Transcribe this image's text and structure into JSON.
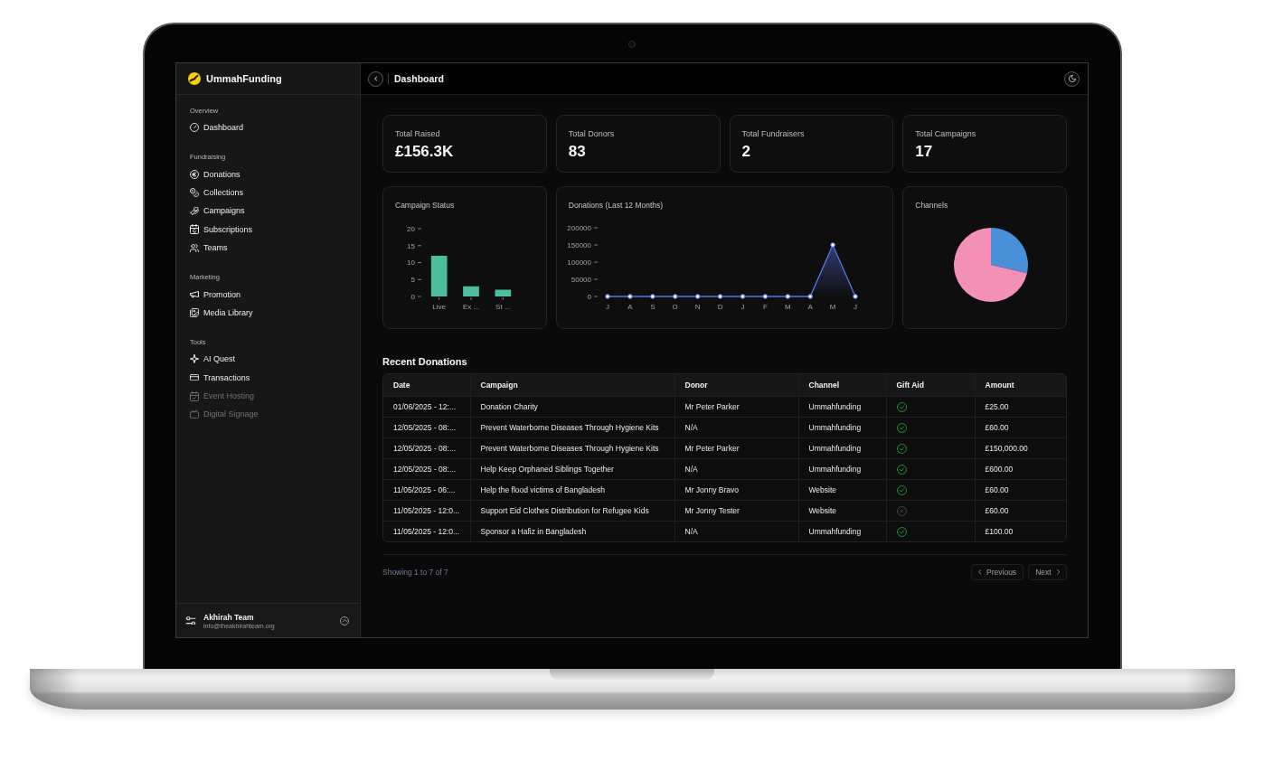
{
  "sidebar": {
    "brand": "UmmahFunding",
    "sections": [
      {
        "title": "Overview",
        "items": [
          {
            "label": "Dashboard",
            "disabled": false
          }
        ]
      },
      {
        "title": "Fundraising",
        "items": [
          {
            "label": "Donations",
            "disabled": false
          },
          {
            "label": "Collections",
            "disabled": false
          },
          {
            "label": "Campaigns",
            "disabled": false
          },
          {
            "label": "Subscriptions",
            "disabled": false
          },
          {
            "label": "Teams",
            "disabled": false
          }
        ]
      },
      {
        "title": "Marketing",
        "items": [
          {
            "label": "Promotion",
            "disabled": false
          },
          {
            "label": "Media Library",
            "disabled": false
          }
        ]
      },
      {
        "title": "Tools",
        "items": [
          {
            "label": "AI Quest",
            "disabled": false
          },
          {
            "label": "Transactions",
            "disabled": false
          },
          {
            "label": "Event Hosting",
            "disabled": true
          },
          {
            "label": "Digital Signage",
            "disabled": true
          }
        ]
      }
    ],
    "user": {
      "name": "Akhirah Team",
      "email": "info@theakhirahteam.org"
    }
  },
  "header": {
    "title": "Dashboard"
  },
  "stats": [
    {
      "label": "Total Raised",
      "value": "£156.3K"
    },
    {
      "label": "Total Donors",
      "value": "83"
    },
    {
      "label": "Total Fundraisers",
      "value": "2"
    },
    {
      "label": "Total Campaigns",
      "value": "17"
    }
  ],
  "charts": {
    "campaign_status": {
      "chart_data": {
        "type": "bar",
        "title": "Campaign Status",
        "categories": [
          "Live",
          "Ex ...",
          "St ..."
        ],
        "values": [
          12,
          3,
          2
        ],
        "ylim": [
          0,
          20
        ],
        "yticks": [
          0,
          5,
          10,
          15,
          20
        ]
      }
    },
    "donations": {
      "chart_data": {
        "type": "area",
        "title": "Donations (Last 12 Months)",
        "categories": [
          "J",
          "A",
          "S",
          "O",
          "N",
          "D",
          "J",
          "F",
          "M",
          "A",
          "M",
          "J"
        ],
        "values": [
          0,
          0,
          0,
          0,
          0,
          0,
          0,
          0,
          0,
          0,
          150000,
          0
        ],
        "ylim": [
          0,
          200000
        ],
        "yticks": [
          0,
          50000,
          100000,
          150000,
          200000
        ]
      }
    },
    "channels": {
      "chart_data": {
        "type": "pie",
        "title": "Channels",
        "values": [
          28.6,
          71.4
        ],
        "colors": [
          "#4a90d9",
          "#f48fb6"
        ]
      }
    }
  },
  "recent_donations": {
    "title": "Recent Donations",
    "columns": [
      "Date",
      "Campaign",
      "Donor",
      "Channel",
      "Gift Aid",
      "Amount"
    ],
    "rows": [
      {
        "date": "01/06/2025 - 12:...",
        "campaign": "Donation Charity",
        "donor": "Mr Peter Parker",
        "channel": "Ummahfunding",
        "gift_aid": true,
        "amount": "£25.00"
      },
      {
        "date": "12/05/2025 - 08:...",
        "campaign": "Prevent Waterborne Diseases Through Hygiene Kits",
        "donor": "N/A",
        "channel": "Ummahfunding",
        "gift_aid": true,
        "amount": "£60.00"
      },
      {
        "date": "12/05/2025 - 08:...",
        "campaign": "Prevent Waterborne Diseases Through Hygiene Kits",
        "donor": "Mr Peter Parker",
        "channel": "Ummahfunding",
        "gift_aid": true,
        "amount": "£150,000.00"
      },
      {
        "date": "12/05/2025 - 08:...",
        "campaign": "Help Keep Orphaned Siblings Together",
        "donor": "N/A",
        "channel": "Ummahfunding",
        "gift_aid": true,
        "amount": "£600.00"
      },
      {
        "date": "11/05/2025 - 06:...",
        "campaign": "Help the flood victims of Bangladesh",
        "donor": "Mr Jonny Bravo",
        "channel": "Website",
        "gift_aid": true,
        "amount": "£60.00"
      },
      {
        "date": "11/05/2025 - 12:0...",
        "campaign": "Support Eid Clothes Distribution for Refugee Kids",
        "donor": "Mr Jonny Tester",
        "channel": "Website",
        "gift_aid": false,
        "amount": "£60.00"
      },
      {
        "date": "11/05/2025 - 12:0...",
        "campaign": "Sponsor a Hafiz in Bangladesh",
        "donor": "N/A",
        "channel": "Ummahfunding",
        "gift_aid": true,
        "amount": "£100.00"
      }
    ]
  },
  "pagination": {
    "summary": "Showing 1 to 7 of 7",
    "previous": "Previous",
    "next": "Next"
  }
}
